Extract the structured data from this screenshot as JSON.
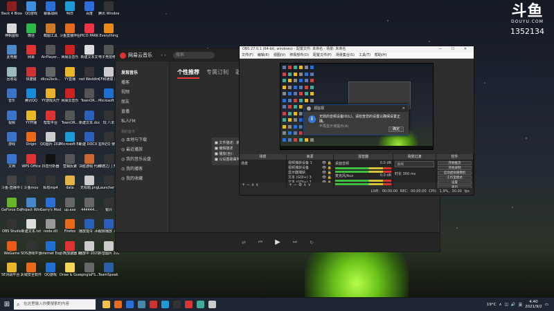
{
  "desktop_icons": [
    {
      "label": "Back 4 Blood Beta",
      "color": "#8b1e1e"
    },
    {
      "label": "QQ游戏",
      "color": "#3f8ee0"
    },
    {
      "label": "暴暴战网",
      "color": "#2a6fd6"
    },
    {
      "label": "明日",
      "color": "#1f9ad8"
    },
    {
      "label": "百度",
      "color": "#2d6cd9"
    },
    {
      "label": "腾讯 Windows...",
      "color": "#333"
    },
    {
      "label": "神帆图标",
      "color": "#d9d9d9"
    },
    {
      "label": "微信",
      "color": "#2fb84a"
    },
    {
      "label": "截图工具",
      "color": "#cc7a28"
    },
    {
      "label": "斗鱼直播伴侣",
      "color": "#e36b1b"
    },
    {
      "label": "PICO PARK",
      "color": "#e34"
    },
    {
      "label": "Everything",
      "color": "#e88a1a"
    },
    {
      "label": "此电脑",
      "color": "#4d89c7"
    },
    {
      "label": "网易",
      "color": "#d33"
    },
    {
      "label": "AirPlayer...",
      "color": "#555"
    },
    {
      "label": "网易云音乐",
      "color": "#c22"
    },
    {
      "label": "新建文本文",
      "color": "#ddd"
    },
    {
      "label": "电子竞技修 使用指引",
      "color": "#555"
    },
    {
      "label": "回收站",
      "color": "#9bb"
    },
    {
      "label": "快捷键",
      "color": "#c33"
    },
    {
      "label": "dlica2bcb...",
      "color": "#666"
    },
    {
      "label": "YY直播",
      "color": "#e8b72a"
    },
    {
      "label": "red Wedding...",
      "color": "#333"
    },
    {
      "label": "CF和通拨 技大区",
      "color": "#ccc"
    },
    {
      "label": "音乐",
      "color": "#3a74c9"
    },
    {
      "label": "腾讯QQ",
      "color": "#1a8ad8"
    },
    {
      "label": "YY游戏大厅",
      "color": "#e7b12b"
    },
    {
      "label": "网易云音乐",
      "color": "#c22"
    },
    {
      "label": "TownOR...",
      "color": "#555"
    },
    {
      "label": "Microsoft Store",
      "color": "#1e6fd0"
    },
    {
      "label": "视频",
      "color": "#3a74c9"
    },
    {
      "label": "YY开播",
      "color": "#e8b72a"
    },
    {
      "label": "帮帮平台",
      "color": "#d33"
    },
    {
      "label": "TownOR...",
      "color": "#555"
    },
    {
      "label": "新建文本.doc",
      "color": "#2b5fb8"
    },
    {
      "label": "玩 八本",
      "color": "#333"
    },
    {
      "label": "游戏",
      "color": "#3a74c9"
    },
    {
      "label": "Origin",
      "color": "#e86a1a"
    },
    {
      "label": "QQ图片 20210...",
      "color": "#ccc"
    },
    {
      "label": "Microsoft Edge",
      "color": "#1e9ad8"
    },
    {
      "label": "新建 DOCX 文档.docx",
      "color": "#2b5fb8"
    },
    {
      "label": "在B记Q 使用指南",
      "color": "#333"
    },
    {
      "label": "文档",
      "color": "#3a74c9"
    },
    {
      "label": "WPS Office",
      "color": "#d33"
    },
    {
      "label": "抖音分析器",
      "color": "#111"
    },
    {
      "label": "营销反聚",
      "color": "#555"
    },
    {
      "label": "决胜游戏 代刷签",
      "color": "#c63"
    },
    {
      "label": "博德之门 开始菜单",
      "color": "#333"
    },
    {
      "label": "斗鱼-直播中 的.mov",
      "color": "#444"
    },
    {
      "label": "斗鱼mov",
      "color": "#333"
    },
    {
      "label": "私有mp4",
      "color": "#333"
    },
    {
      "label": "data",
      "color": "#e3b34a"
    },
    {
      "label": "无标题.png",
      "color": "#ccc"
    },
    {
      "label": "Launcher 快捷方式",
      "color": "#333"
    },
    {
      "label": "GeForce Experience",
      "color": "#6ab42a"
    },
    {
      "label": "Project Winter",
      "color": "#48c"
    },
    {
      "label": "Garry's Mod",
      "color": "#2a6fd6"
    },
    {
      "label": "up.exe",
      "color": "#666"
    },
    {
      "label": "444444...",
      "color": "#666"
    },
    {
      "label": "银兴",
      "color": "#333"
    },
    {
      "label": "OBS Studio",
      "color": "#333"
    },
    {
      "label": "新建文本.txt",
      "color": "#ddd"
    },
    {
      "label": "node.dll",
      "color": "#999"
    },
    {
      "label": "Firefox",
      "color": "#e86a1a"
    },
    {
      "label": "播放指令 .doc",
      "color": "#2b5fb8"
    },
    {
      "label": "视频播放 .doc",
      "color": "#2b5fb8"
    },
    {
      "label": "WeGame",
      "color": "#e85a1a"
    },
    {
      "label": "SDS游戏平台",
      "color": "#333"
    },
    {
      "label": "Internet Explorer",
      "color": "#1e6fd0"
    },
    {
      "label": "小熊加速器 助手",
      "color": "#d33"
    },
    {
      "label": "播放中 20210...",
      "color": "#ccc"
    },
    {
      "label": "抖音图片 20210...",
      "color": "#ccc"
    },
    {
      "label": "5E对战平台 2.0",
      "color": "#e8b72a"
    },
    {
      "label": "火绒安全软件",
      "color": "#e86a1a"
    },
    {
      "label": "QQ游戏",
      "color": "#1e6fd0"
    },
    {
      "label": "Draw & Guess",
      "color": "#f5d65a"
    },
    {
      "label": "spnglaFS...",
      "color": "#666"
    },
    {
      "label": "TeamSpeak 3",
      "color": "#2a5fa8"
    }
  ],
  "watermark": {
    "logo": "斗鱼",
    "domain": "DOUYU.COM",
    "room_id": "1352134"
  },
  "music_app": {
    "name": "网易云音乐",
    "search_placeholder": "搜索",
    "sidebar": {
      "items": [
        "发现音乐",
        "播客",
        "视频",
        "朋友",
        "直播",
        "私人FM"
      ],
      "section_title": "我的音乐",
      "my_items": [
        "本地与下载",
        "最近播放",
        "我的音乐云盘",
        "我的播客",
        "我的收藏"
      ]
    },
    "tabs": [
      "个性推荐",
      "专属订制",
      "歌单"
    ],
    "dropdown_items": [
      "文件描述：新",
      "编辑描述",
      "播放(自)：",
      "以设置歌曲列表"
    ]
  },
  "obs": {
    "title": "OBS 27.0.1 (64-bit, windows) - 配置文件: 未命名 - 场景: 未命名",
    "window_controls": "— ☐ ✕",
    "menu": [
      "文件(F)",
      "编辑(E)",
      "视图(V)",
      "停靠部件(D)",
      "配置文件(P)",
      "场景集合(S)",
      "工具(T)",
      "帮助(H)"
    ],
    "dialog": {
      "title": "源监视",
      "message": "无效的音频设备ID(L)，请检查您的设置以确保设置正确。",
      "message2": "不再显示该提示(A)",
      "ok": "确定"
    },
    "docks": {
      "scenes_title": "场景",
      "scene_item": "场景",
      "sources_title": "来源",
      "sources": [
        {
          "name": "视频捕获设备 1",
          "vis": "👁 🔒"
        },
        {
          "name": "视频捕获设备",
          "vis": "👁 🔒"
        },
        {
          "name": "显示器捕获",
          "vis": "👁 🔒"
        },
        {
          "name": "文本 (GDI+) 3",
          "vis": "👁 🔒"
        },
        {
          "name": "文本 (GDI+) 2",
          "vis": "👁 🔒"
        },
        {
          "name": "窗口捕获 1",
          "vis": "👁 🔒"
        }
      ],
      "mixer_title": "混音器",
      "mixer_channels": [
        {
          "name": "桌面音频",
          "db": "0.0 dB"
        },
        {
          "name": "麦克风/Aux",
          "db": "0.0 dB"
        }
      ],
      "transitions_title": "场景过渡",
      "transition_type": "淡出",
      "transition_duration": "时长  300 ms",
      "controls_title": "控件",
      "controls": [
        "开始推流",
        "开始录制",
        "启动虚拟摄像机",
        "工作室模式",
        "设置",
        "退出"
      ]
    },
    "status": "LIVE: 00:00:00    REC: 00:00:00    CPU: 1.9%, 30.00 fps"
  },
  "taskbar": {
    "search_placeholder": "在这里输入你要搜索的内容",
    "weather": "19°C",
    "time": "4:40",
    "date": "2021/9/2",
    "ime": "英",
    "app_colors": [
      "#f2c14e",
      "#e86a1a",
      "#2a6fd6",
      "#48a",
      "#c33",
      "#1e9ad8",
      "#333",
      "#d33",
      "#4a9",
      "#ccc"
    ]
  }
}
